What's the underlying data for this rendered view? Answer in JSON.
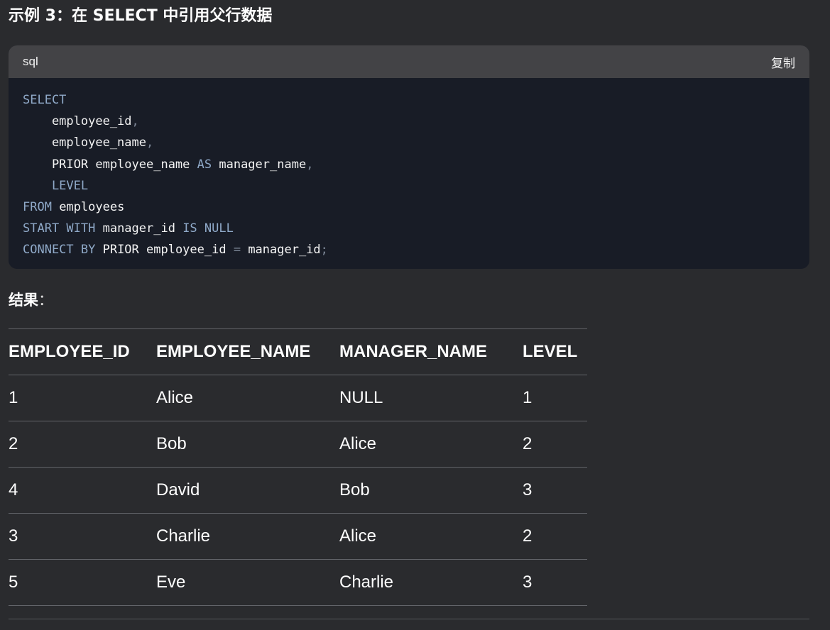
{
  "heading": "示例 3：在 SELECT 中引用父行数据",
  "code_block": {
    "language": "sql",
    "copy_label": "复制",
    "lines": [
      [
        {
          "t": "kw",
          "v": "SELECT"
        }
      ],
      [
        {
          "t": "id",
          "v": "    employee_id"
        },
        {
          "t": "p",
          "v": ","
        }
      ],
      [
        {
          "t": "id",
          "v": "    employee_name"
        },
        {
          "t": "p",
          "v": ","
        }
      ],
      [
        {
          "t": "id",
          "v": "    PRIOR employee_name "
        },
        {
          "t": "kw",
          "v": "AS"
        },
        {
          "t": "id",
          "v": " manager_name"
        },
        {
          "t": "p",
          "v": ","
        }
      ],
      [
        {
          "t": "kw",
          "v": "    LEVEL"
        }
      ],
      [
        {
          "t": "kw",
          "v": "FROM"
        },
        {
          "t": "id",
          "v": " employees"
        }
      ],
      [
        {
          "t": "kw",
          "v": "START WITH"
        },
        {
          "t": "id",
          "v": " manager_id "
        },
        {
          "t": "kw",
          "v": "IS NULL"
        }
      ],
      [
        {
          "t": "kw",
          "v": "CONNECT BY"
        },
        {
          "t": "id",
          "v": " PRIOR employee_id "
        },
        {
          "t": "p",
          "v": "="
        },
        {
          "t": "id",
          "v": " manager_id"
        },
        {
          "t": "p",
          "v": ";"
        }
      ]
    ]
  },
  "result": {
    "label": "结果",
    "colon": "："
  },
  "table": {
    "columns": [
      "EMPLOYEE_ID",
      "EMPLOYEE_NAME",
      "MANAGER_NAME",
      "LEVEL"
    ],
    "rows": [
      [
        "1",
        "Alice",
        "NULL",
        "1"
      ],
      [
        "2",
        "Bob",
        "Alice",
        "2"
      ],
      [
        "4",
        "David",
        "Bob",
        "3"
      ],
      [
        "3",
        "Charlie",
        "Alice",
        "2"
      ],
      [
        "5",
        "Eve",
        "Charlie",
        "3"
      ]
    ]
  },
  "colors": {
    "background": "#2a2b2e",
    "code_background": "#181c26",
    "code_header": "#434346",
    "keyword": "#8fa9c8",
    "identifier": "#f4f4f4"
  }
}
